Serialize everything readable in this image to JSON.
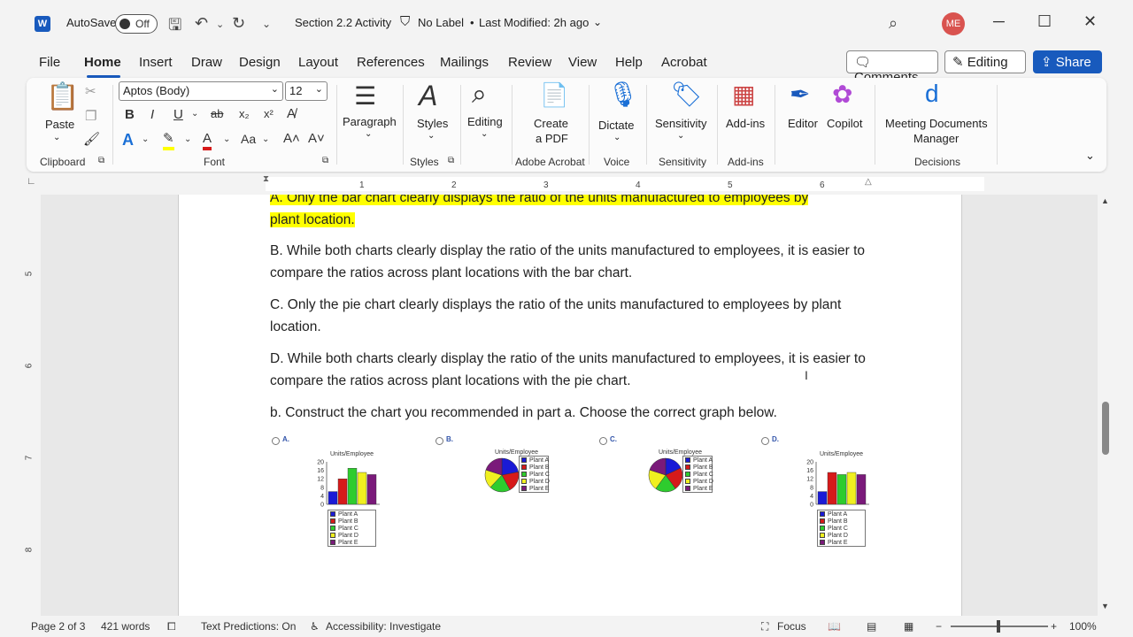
{
  "titlebar": {
    "app_icon": "W",
    "autosave_label": "AutoSave",
    "autosave_state": "Off",
    "doc_title": "Section 2.2 Activity",
    "label_status": "No Label",
    "bullet": "•",
    "last_modified": "Last Modified: 2h ago",
    "user_initials": "ME"
  },
  "menu": {
    "items": [
      "File",
      "Home",
      "Insert",
      "Draw",
      "Design",
      "Layout",
      "References",
      "Mailings",
      "Review",
      "View",
      "Help",
      "Acrobat"
    ],
    "comments_label": "Comments",
    "editing_label": "Editing",
    "share_label": "Share"
  },
  "ribbon": {
    "paste_label": "Paste",
    "clipboard_group": "Clipboard",
    "font_name": "Aptos (Body)",
    "font_size": "12",
    "font_group": "Font",
    "paragraph_label": "Paragraph",
    "styles_label": "Styles",
    "styles_group": "Styles",
    "editing_label": "Editing",
    "create_pdf_line1": "Create",
    "create_pdf_line2": "a PDF",
    "acrobat_group": "Adobe Acrobat",
    "dictate_label": "Dictate",
    "voice_group": "Voice",
    "sensitivity_label": "Sensitivity",
    "sensitivity_group": "Sensitivity",
    "addins_label": "Add-ins",
    "addins_group": "Add-ins",
    "editor_label": "Editor",
    "copilot_label": "Copilot",
    "meeting_line1": "Meeting Documents",
    "meeting_line2": "Manager",
    "decisions_group": "Decisions",
    "font_buttons": [
      "B",
      "I",
      "U",
      "ab",
      "x₂",
      "x²"
    ]
  },
  "ruler": {
    "numbers": [
      "1",
      "2",
      "3",
      "4",
      "5",
      "6"
    ],
    "vertical_numbers": [
      "5",
      "6",
      "7",
      "8"
    ]
  },
  "document": {
    "para_a_line1": "A. Only the bar chart clearly displays the ratio of the units manufactured to employees by",
    "para_a_line2": "plant location.",
    "para_b": "B. While both charts clearly display the ratio of the units manufactured to employees, it is easier to compare the ratios across plant locations with the bar chart.",
    "para_c": "C. Only the pie chart clearly displays the ratio of the units manufactured to employees by plant location.",
    "para_d": "D. While both charts clearly display the ratio of the units manufactured to employees, it is easier to compare the ratios across plant locations with the pie chart.",
    "para_e": "b. Construct the chart you recommended in part a. Choose the correct graph below."
  },
  "options": [
    {
      "label": "A.",
      "type": "bar",
      "title": "Units/Employee",
      "values": [
        6,
        12,
        17,
        15,
        14
      ]
    },
    {
      "label": "B.",
      "type": "pie",
      "title": "Units/Employee"
    },
    {
      "label": "C.",
      "type": "pie",
      "title": "Units/Employee"
    },
    {
      "label": "D.",
      "type": "bar",
      "title": "Units/Employee",
      "values": [
        6,
        15,
        14,
        15,
        14
      ]
    }
  ],
  "chart_data": [
    {
      "type": "bar",
      "title": "Units/Employee",
      "categories": [
        "Plant A",
        "Plant B",
        "Plant C",
        "Plant D",
        "Plant E"
      ],
      "values": [
        6,
        12,
        17,
        15,
        14
      ],
      "ylim": [
        0,
        20
      ],
      "yticks": [
        "0",
        "4",
        "8",
        "12",
        "16",
        "20"
      ]
    },
    {
      "type": "pie",
      "title": "Units/Employee",
      "categories": [
        "Plant A",
        "Plant B",
        "Plant C",
        "Plant D",
        "Plant E"
      ],
      "values": [
        22,
        20,
        20,
        18,
        20
      ]
    },
    {
      "type": "pie",
      "title": "Units/Employee",
      "categories": [
        "Plant A",
        "Plant B",
        "Plant C",
        "Plant D",
        "Plant E"
      ],
      "values": [
        18,
        22,
        20,
        20,
        20
      ]
    },
    {
      "type": "bar",
      "title": "Units/Employee",
      "categories": [
        "Plant A",
        "Plant B",
        "Plant C",
        "Plant D",
        "Plant E"
      ],
      "values": [
        6,
        15,
        14,
        15,
        14
      ],
      "ylim": [
        0,
        20
      ],
      "yticks": [
        "0",
        "4",
        "8",
        "12",
        "16",
        "20"
      ]
    }
  ],
  "series_colors": [
    "#1a1ad6",
    "#d61a1a",
    "#2ecc2e",
    "#f0f020",
    "#7a1a7a"
  ],
  "legend_labels": [
    "Plant A",
    "Plant B",
    "Plant C",
    "Plant D",
    "Plant E"
  ],
  "status": {
    "page": "Page 2 of 3",
    "words": "421 words",
    "text_predictions": "Text Predictions: On",
    "accessibility": "Accessibility: Investigate",
    "focus": "Focus",
    "zoom": "100%"
  }
}
